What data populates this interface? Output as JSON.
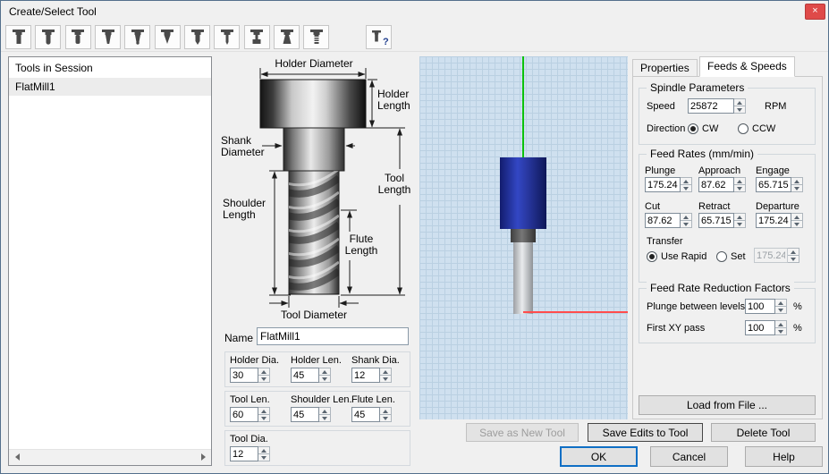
{
  "window": {
    "title": "Create/Select Tool",
    "close_glyph": "×"
  },
  "toolbar": {
    "tool_names": [
      "flat-mill",
      "ball-mill",
      "corner-radius-mill",
      "taper-mill",
      "taper-ball-mill",
      "v-bit-mill",
      "drill",
      "center-drill",
      "t-slot-mill",
      "dove-mill",
      "thread-mill"
    ],
    "help_glyph": "?"
  },
  "session": {
    "header": "Tools in Session",
    "items": [
      {
        "name": "FlatMill1"
      }
    ]
  },
  "diagram": {
    "holder_diameter": "Holder Diameter",
    "holder_length": "Holder Length",
    "shank_diameter": "Shank Diameter",
    "tool_length": "Tool Length",
    "shoulder_length": "Shoulder Length",
    "flute_length": "Flute Length",
    "tool_diameter": "Tool Diameter"
  },
  "name_field": {
    "label": "Name",
    "value": "FlatMill1"
  },
  "params": {
    "groups": [
      {
        "fields": [
          {
            "label": "Holder Dia.",
            "value": "30"
          },
          {
            "label": "Holder Len.",
            "value": "45"
          },
          {
            "label": "Shank Dia.",
            "value": "12"
          }
        ]
      },
      {
        "fields": [
          {
            "label": "Tool Len.",
            "value": "60"
          },
          {
            "label": "Shoulder Len.",
            "value": "45"
          },
          {
            "label": "Flute Len.",
            "value": "45"
          }
        ]
      },
      {
        "fields": [
          {
            "label": "Tool Dia.",
            "value": "12"
          }
        ]
      }
    ]
  },
  "tabs": [
    {
      "label": "Properties"
    },
    {
      "label": "Feeds & Speeds"
    }
  ],
  "spindle": {
    "group_label": "Spindle Parameters",
    "speed_label": "Speed",
    "speed_value": "25872",
    "speed_unit": "RPM",
    "direction_label": "Direction",
    "cw_label": "CW",
    "ccw_label": "CCW"
  },
  "feed_rates": {
    "group_label": "Feed Rates (mm/min)",
    "fields": [
      {
        "label": "Plunge",
        "value": "175.24"
      },
      {
        "label": "Approach",
        "value": "87.62"
      },
      {
        "label": "Engage",
        "value": "65.715"
      },
      {
        "label": "Cut",
        "value": "87.62"
      },
      {
        "label": "Retract",
        "value": "65.715"
      },
      {
        "label": "Departure",
        "value": "175.24"
      }
    ],
    "transfer_label": "Transfer",
    "use_rapid_label": "Use Rapid",
    "set_label": "Set",
    "set_value": "175.24"
  },
  "reduction": {
    "group_label": "Feed Rate Reduction Factors",
    "fields": [
      {
        "label": "Plunge between levels",
        "value": "100",
        "unit": "%"
      },
      {
        "label": "First XY pass",
        "value": "100",
        "unit": "%"
      }
    ]
  },
  "buttons": {
    "load_from_file": "Load from File ...",
    "save_as_new": "Save as New Tool",
    "save_edits": "Save Edits to Tool",
    "delete_tool": "Delete Tool",
    "ok": "OK",
    "cancel": "Cancel",
    "help": "Help"
  }
}
